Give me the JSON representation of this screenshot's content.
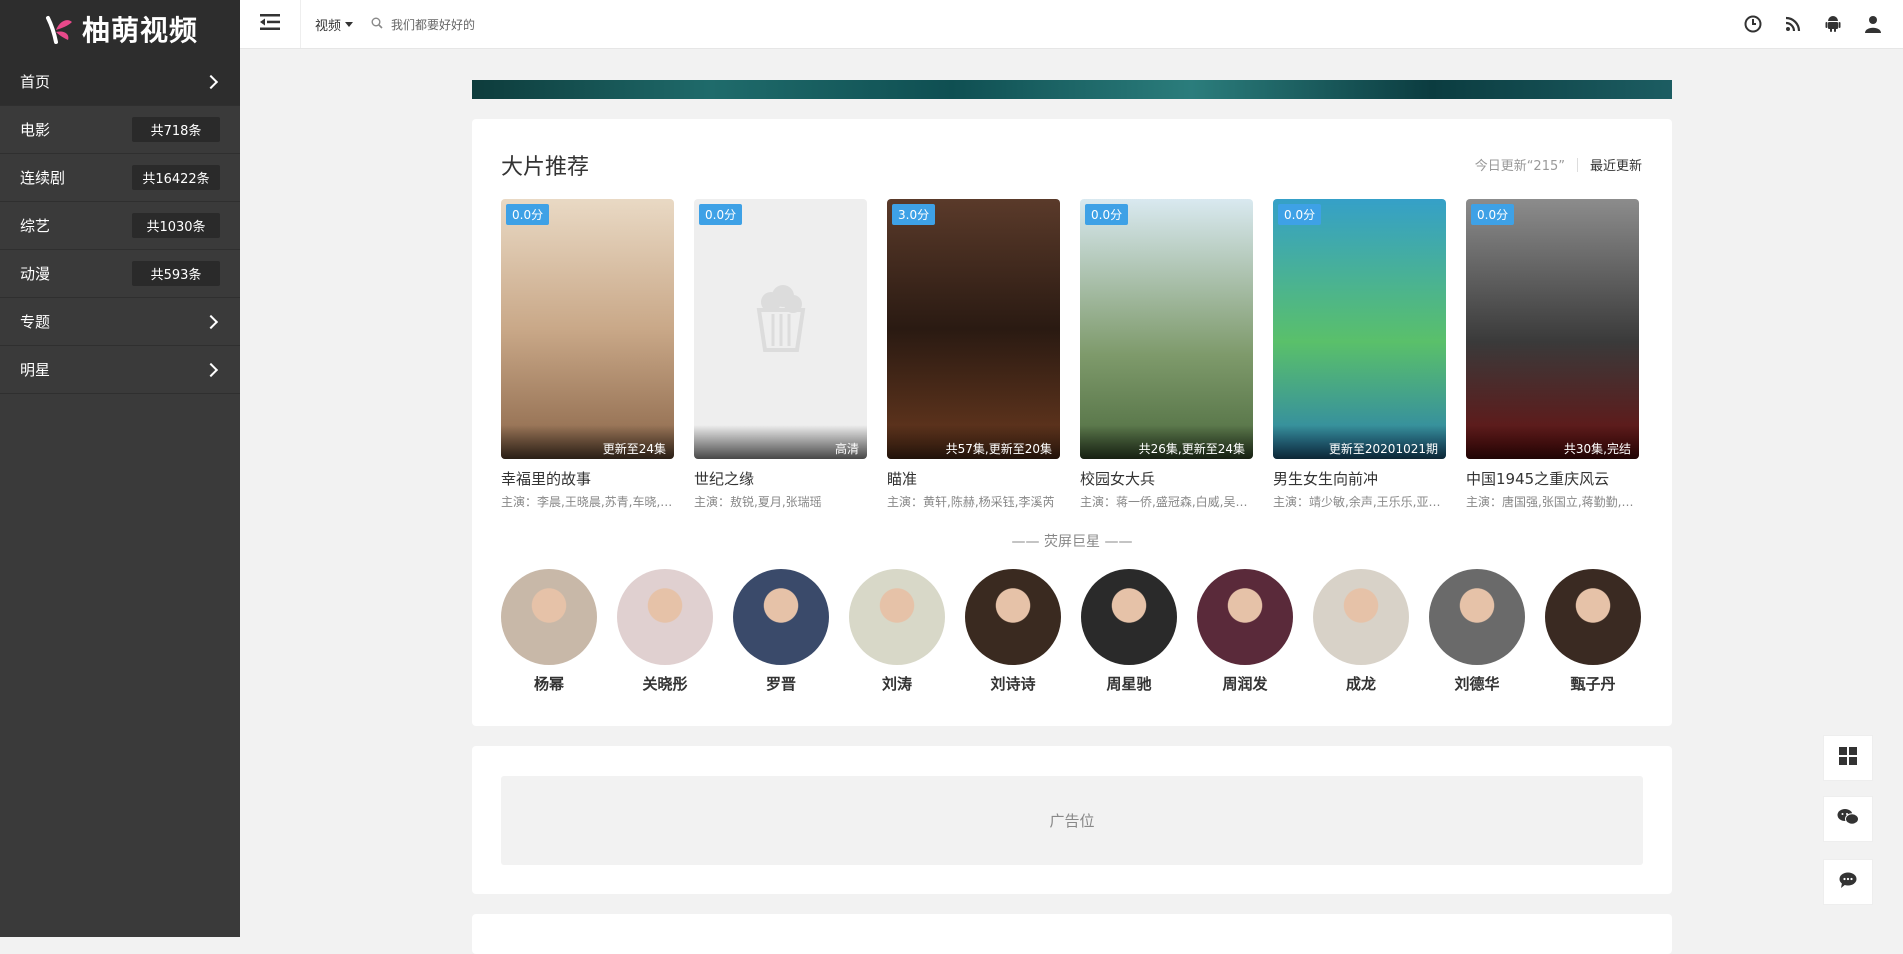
{
  "app": {
    "logo_text": "柚萌视频"
  },
  "sidebar": {
    "items": [
      {
        "label": "首页",
        "count": "",
        "arrow": true
      },
      {
        "label": "电影",
        "count": "共718条",
        "arrow": false
      },
      {
        "label": "连续剧",
        "count": "共16422条",
        "arrow": false
      },
      {
        "label": "综艺",
        "count": "共1030条",
        "arrow": false
      },
      {
        "label": "动漫",
        "count": "共593条",
        "arrow": false
      },
      {
        "label": "专题",
        "count": "",
        "arrow": true
      },
      {
        "label": "明星",
        "count": "",
        "arrow": true
      }
    ]
  },
  "topbar": {
    "channel": "视频",
    "search_placeholder": "我们都要好好的",
    "icons": [
      "history-icon",
      "rss-icon",
      "android-icon",
      "user-icon"
    ]
  },
  "section": {
    "title": "大片推荐",
    "today_update": "今日更新“215”",
    "recent_update": "最近更新"
  },
  "movies": [
    {
      "title": "幸福里的故事",
      "score": "0.0分",
      "status": "更新至24集",
      "cast": "主演：李晨,王晓晨,苏青,车晓,…"
    },
    {
      "title": "世纪之缘",
      "score": "0.0分",
      "status": "高清",
      "cast": "主演：敖锐,夏月,张瑞瑶"
    },
    {
      "title": "瞄准",
      "score": "3.0分",
      "status": "共57集,更新至20集",
      "cast": "主演：黄轩,陈赫,杨采钰,李溪芮"
    },
    {
      "title": "校园女大兵",
      "score": "0.0分",
      "status": "共26集,更新至24集",
      "cast": "主演：蒋一侨,盛冠森,白威,吴…"
    },
    {
      "title": "男生女生向前冲",
      "score": "0.0分",
      "status": "更新至20201021期",
      "cast": "主演：靖少敏,余声,王乐乐,亚…"
    },
    {
      "title": "中国1945之重庆风云",
      "score": "0.0分",
      "status": "共30集,完结",
      "cast": "主演：唐国强,张国立,蒋勤勤,…"
    }
  ],
  "stars_heading": "—— 荧屏巨星 ——",
  "stars": [
    "杨幂",
    "关晓彤",
    "罗晋",
    "刘涛",
    "刘诗诗",
    "周星驰",
    "周润发",
    "成龙",
    "刘德华",
    "甄子丹"
  ],
  "ad": {
    "label": "广告位"
  },
  "float_buttons": [
    "windows-icon",
    "wechat-icon",
    "chat-icon"
  ],
  "colors": {
    "accent": "#3ea1e6",
    "sidebar": "#3a3a3a"
  }
}
